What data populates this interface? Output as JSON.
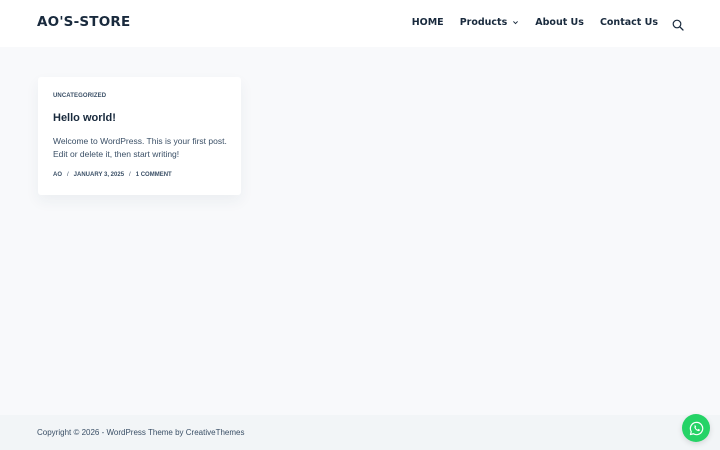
{
  "site": {
    "logo_text": "AO'S-STORE"
  },
  "nav": {
    "items": [
      {
        "label": "HOME",
        "has_dropdown": false
      },
      {
        "label": "Products",
        "has_dropdown": true
      },
      {
        "label": "About Us",
        "has_dropdown": false
      },
      {
        "label": "Contact Us",
        "has_dropdown": false
      }
    ],
    "search_icon": "search-icon"
  },
  "post": {
    "category": "UNCATEGORIZED",
    "title": "Hello world!",
    "excerpt": "Welcome to WordPress. This is your first post. Edit or delete it, then start writing!",
    "author": "AO",
    "date": "JANUARY 3, 2025",
    "comments": "1 COMMENT",
    "separator": "/"
  },
  "footer": {
    "copyright": "Copyright © 2026 - WordPress Theme by CreativeThemes"
  },
  "floating": {
    "whatsapp_icon": "whatsapp-icon",
    "color": "#25d366"
  },
  "colors": {
    "background": "#f8f9fb",
    "header_bg": "#ffffff",
    "footer_bg": "#f2f5f7",
    "heading": "#192a3d",
    "text": "#3a4f66"
  }
}
